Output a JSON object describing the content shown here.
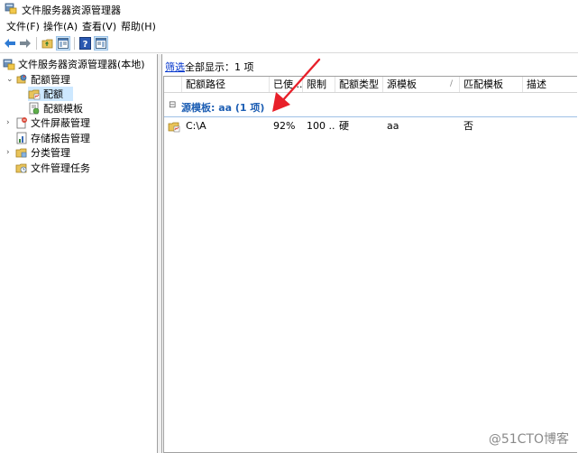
{
  "window": {
    "title": "文件服务器资源管理器"
  },
  "menu": [
    {
      "id": "file",
      "label": "文件(F)"
    },
    {
      "id": "action",
      "label": "操作(A)"
    },
    {
      "id": "view",
      "label": "查看(V)"
    },
    {
      "id": "help",
      "label": "帮助(H)"
    }
  ],
  "tree": {
    "root": "文件服务器资源管理器(本地)",
    "quota_mgmt": "配额管理",
    "quota": "配额",
    "quota_templates": "配额模板",
    "file_screen": "文件屏蔽管理",
    "storage_reports": "存储报告管理",
    "classification": "分类管理",
    "file_tasks": "文件管理任务"
  },
  "filter": {
    "link": "筛选",
    "text": "全部显示：1 项"
  },
  "columns": [
    {
      "id": "path",
      "label": "配额路径"
    },
    {
      "id": "used",
      "label": "已使..."
    },
    {
      "id": "limit",
      "label": "限制"
    },
    {
      "id": "type",
      "label": "配额类型"
    },
    {
      "id": "source",
      "label": "源模板"
    },
    {
      "id": "match",
      "label": "匹配模板"
    },
    {
      "id": "desc",
      "label": "描述"
    }
  ],
  "group": {
    "label": "源模板: aa (1 项)"
  },
  "rows": [
    {
      "path": "C:\\A",
      "used": "92%",
      "limit": "100 ...",
      "type": "硬",
      "source": "aa",
      "match": "否",
      "desc": ""
    }
  ],
  "watermark": "@51CTO博客",
  "colors": {
    "accent": "#1e5fb4",
    "selection": "#cde8ff",
    "arrow": "#e8202a"
  }
}
